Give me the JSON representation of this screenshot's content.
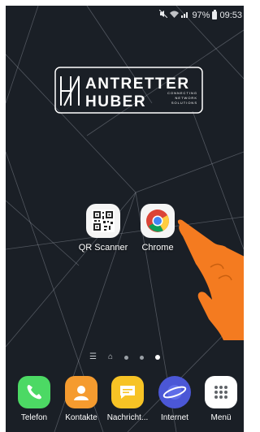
{
  "status_bar": {
    "battery": "97%",
    "time": "09:53",
    "icons": [
      "mute-icon",
      "wifi-icon",
      "signal-icon",
      "battery-icon"
    ]
  },
  "logo": {
    "line1": "ANTRETTER",
    "line2": "HUBER",
    "tagline": [
      "CONNECTING",
      "NETWORK",
      "SOLUTIONS"
    ]
  },
  "home_apps": [
    {
      "label": "QR Scanner",
      "icon": "qr-scanner-icon"
    },
    {
      "label": "Chrome",
      "icon": "chrome-icon"
    }
  ],
  "pager": {
    "pages": 3,
    "active": 2
  },
  "dock": [
    {
      "label": "Telefon",
      "icon": "phone-icon",
      "color": "#4cd964"
    },
    {
      "label": "Kontakte",
      "icon": "contacts-icon",
      "color": "#f59b2f"
    },
    {
      "label": "Nachricht...",
      "icon": "messages-icon",
      "color": "#f7c325"
    },
    {
      "label": "Internet",
      "icon": "internet-icon",
      "color": "#4b57d6"
    },
    {
      "label": "Menü",
      "icon": "apps-menu-icon",
      "color": "#ffffff"
    }
  ],
  "colors": {
    "pointer_hand": "#f47b20",
    "wallpaper": "#1a1f26"
  }
}
